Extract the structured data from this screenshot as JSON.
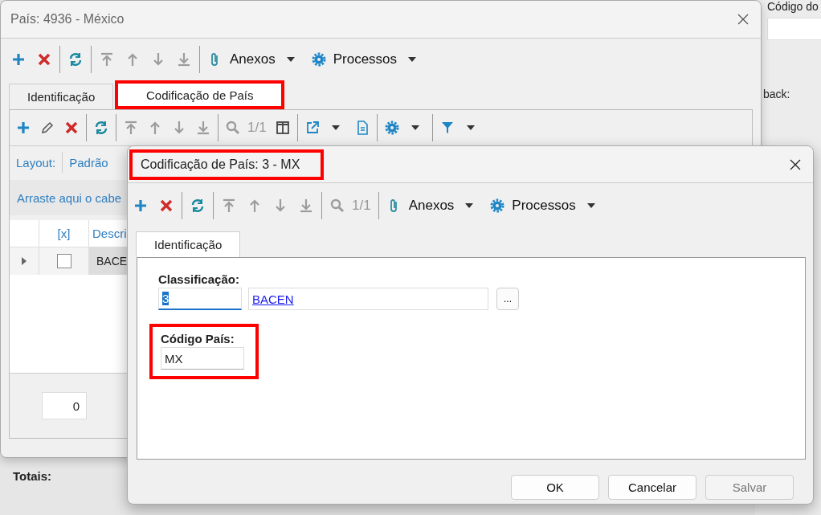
{
  "background_window": {
    "field_label": "Código do",
    "label": "back:",
    "totals_label": "Totais:"
  },
  "main_window": {
    "title": "País: 4936 - México",
    "toolbar": [
      {
        "kind": "add",
        "disabled": false
      },
      {
        "kind": "delete",
        "disabled": false
      },
      {
        "kind": "sep"
      },
      {
        "kind": "refresh",
        "disabled": false
      },
      {
        "kind": "sep"
      },
      {
        "kind": "first",
        "disabled": true
      },
      {
        "kind": "up",
        "disabled": true
      },
      {
        "kind": "down",
        "disabled": true
      },
      {
        "kind": "last",
        "disabled": true
      },
      {
        "kind": "sep"
      },
      {
        "kind": "attach",
        "label": "Anexos",
        "dropdown": true,
        "disabled": false
      },
      {
        "kind": "process",
        "label": "Processos",
        "dropdown": true,
        "disabled": false
      }
    ],
    "tabs": [
      {
        "label": "Identificação",
        "selected": false,
        "highlighted": false
      },
      {
        "label": "Codificação de País",
        "selected": true,
        "highlighted": true
      }
    ],
    "grid_toolbar": [
      {
        "kind": "add",
        "disabled": false
      },
      {
        "kind": "edit",
        "disabled": false
      },
      {
        "kind": "delete",
        "disabled": false
      },
      {
        "kind": "sep"
      },
      {
        "kind": "refresh",
        "disabled": false
      },
      {
        "kind": "sep"
      },
      {
        "kind": "first",
        "disabled": true
      },
      {
        "kind": "up",
        "disabled": true
      },
      {
        "kind": "down",
        "disabled": true
      },
      {
        "kind": "last",
        "disabled": true
      },
      {
        "kind": "sep"
      },
      {
        "kind": "search",
        "label": "1/1",
        "disabled": true
      },
      {
        "kind": "columns",
        "disabled": false
      },
      {
        "kind": "sep"
      },
      {
        "kind": "export",
        "dropdown": true,
        "disabled": false
      },
      {
        "kind": "document",
        "disabled": false
      },
      {
        "kind": "sep"
      },
      {
        "kind": "gear",
        "dropdown": true,
        "disabled": false
      },
      {
        "kind": "sep"
      },
      {
        "kind": "filter",
        "dropdown": true,
        "disabled": false
      }
    ],
    "layout_label": "Layout:",
    "layout_value": "Padrão",
    "group_hint": "Arraste aqui o cabe",
    "columns": [
      "[x]",
      "Descri"
    ],
    "rows": [
      {
        "checked": false,
        "cell": "BACE"
      }
    ],
    "footer_value": "0"
  },
  "dialog": {
    "title": "Codificação de País: 3 - MX",
    "title_highlighted": true,
    "toolbar": [
      {
        "kind": "add",
        "disabled": false
      },
      {
        "kind": "delete",
        "disabled": false
      },
      {
        "kind": "sep"
      },
      {
        "kind": "refresh",
        "disabled": false
      },
      {
        "kind": "sep"
      },
      {
        "kind": "first",
        "disabled": true
      },
      {
        "kind": "up",
        "disabled": true
      },
      {
        "kind": "down",
        "disabled": true
      },
      {
        "kind": "last",
        "disabled": true
      },
      {
        "kind": "sep"
      },
      {
        "kind": "search",
        "label": "1/1",
        "disabled": true
      },
      {
        "kind": "sep"
      },
      {
        "kind": "attach",
        "label": "Anexos",
        "dropdown": true,
        "disabled": false
      },
      {
        "kind": "process",
        "label": "Processos",
        "dropdown": true,
        "disabled": false
      }
    ],
    "tabs": [
      {
        "label": "Identificação",
        "selected": true
      }
    ],
    "classification": {
      "label": "Classificação:",
      "value": "3",
      "focused": true,
      "description": "BACEN",
      "lookup": "..."
    },
    "country_code": {
      "label": "Código País:",
      "value": "MX",
      "highlighted": true
    },
    "buttons": [
      {
        "label": "OK",
        "disabled": false
      },
      {
        "label": "Cancelar",
        "disabled": false
      },
      {
        "label": "Salvar",
        "disabled": true
      }
    ]
  }
}
